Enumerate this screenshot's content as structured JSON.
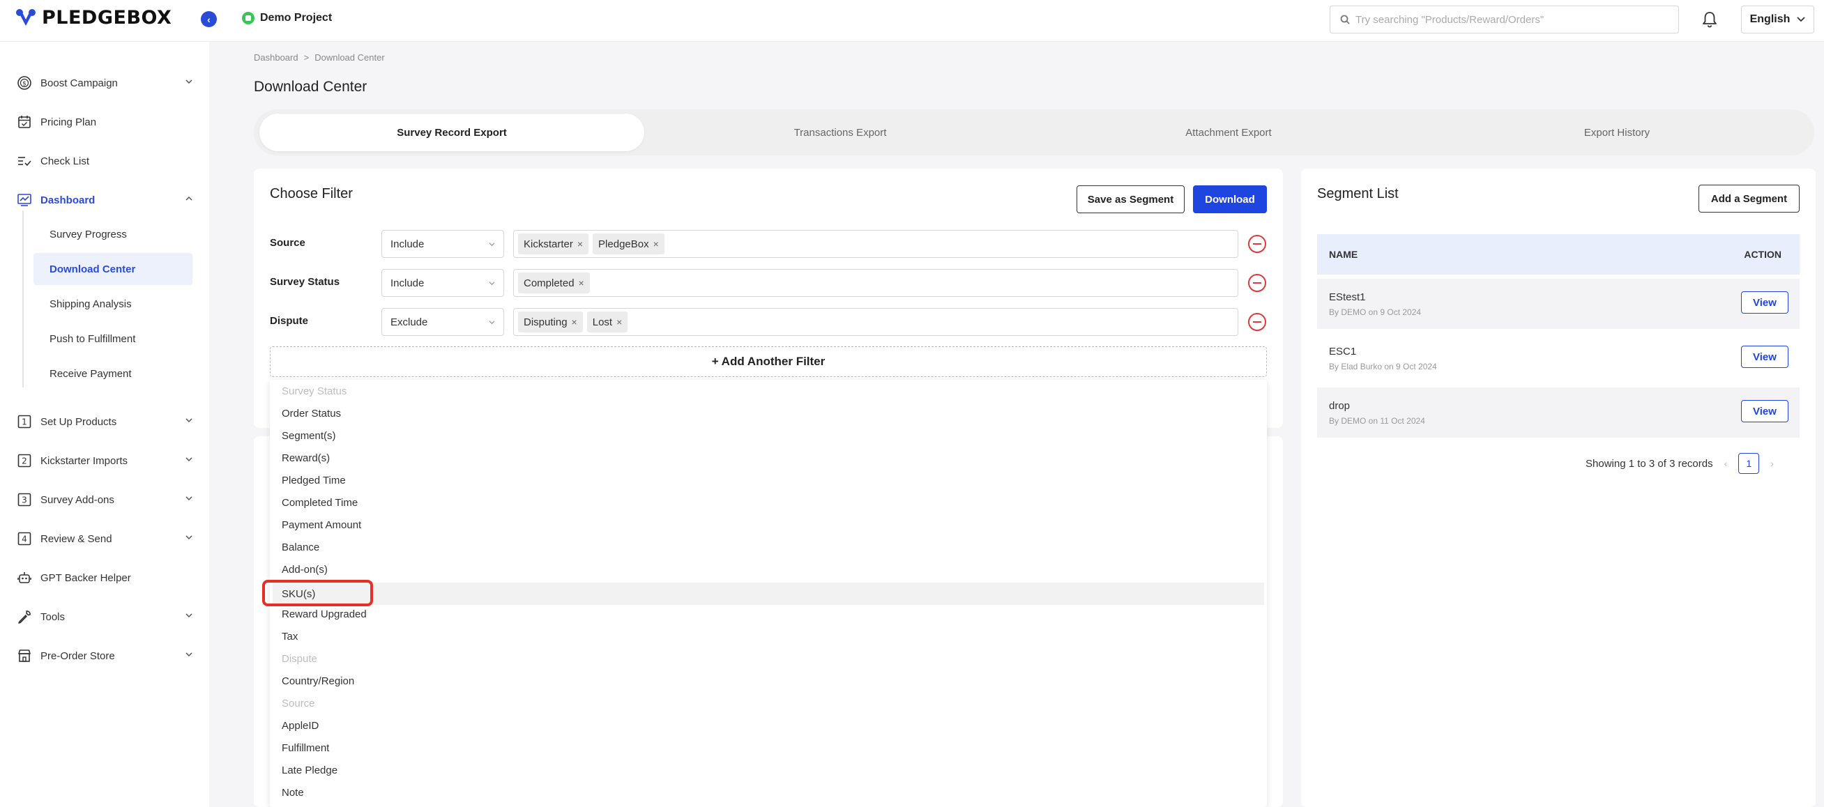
{
  "app": {
    "logo_text": "PLEDGEBOX",
    "project_name": "Demo Project"
  },
  "search": {
    "placeholder": "Try searching \"Products/Reward/Orders\""
  },
  "language": "English",
  "sidebar": {
    "items": [
      {
        "label": "Boost Campaign",
        "icon": "dollar-circle-icon"
      },
      {
        "label": "Pricing Plan",
        "icon": "calendar-icon"
      },
      {
        "label": "Check List",
        "icon": "checklist-icon"
      },
      {
        "label": "Dashboard",
        "icon": "dashboard-chart-icon"
      },
      {
        "label": "Set Up Products",
        "icon": "step-1-icon"
      },
      {
        "label": "Kickstarter Imports",
        "icon": "step-2-icon"
      },
      {
        "label": "Survey Add-ons",
        "icon": "step-3-icon"
      },
      {
        "label": "Review & Send",
        "icon": "step-4-icon"
      },
      {
        "label": "GPT Backer Helper",
        "icon": "robot-icon"
      },
      {
        "label": "Tools",
        "icon": "wrench-icon"
      },
      {
        "label": "Pre-Order Store",
        "icon": "store-icon"
      }
    ],
    "dashboard_sub": [
      {
        "label": "Survey Progress"
      },
      {
        "label": "Download Center"
      },
      {
        "label": "Shipping Analysis"
      },
      {
        "label": "Push to Fulfillment"
      },
      {
        "label": "Receive Payment"
      }
    ]
  },
  "breadcrumb": {
    "root": "Dashboard",
    "sep": ">",
    "current": "Download Center"
  },
  "page_title": "Download Center",
  "tabs": [
    {
      "label": "Survey Record Export"
    },
    {
      "label": "Transactions Export"
    },
    {
      "label": "Attachment Export"
    },
    {
      "label": "Export History"
    }
  ],
  "filter_card": {
    "title": "Choose Filter",
    "save_segment": "Save as Segment",
    "download": "Download",
    "add_filter": "Add Another Filter",
    "add_filter_plus": "+",
    "rows": [
      {
        "label": "Source",
        "mode": "Include",
        "tags": [
          "Kickstarter",
          "PledgeBox"
        ]
      },
      {
        "label": "Survey Status",
        "mode": "Include",
        "tags": [
          "Completed"
        ]
      },
      {
        "label": "Dispute",
        "mode": "Exclude",
        "tags": [
          "Disputing",
          "Lost"
        ]
      }
    ],
    "tag_remove": "×"
  },
  "dropdown": {
    "options": [
      {
        "label": "Survey Status",
        "disabled": true
      },
      {
        "label": "Order Status"
      },
      {
        "label": "Segment(s)"
      },
      {
        "label": "Reward(s)"
      },
      {
        "label": "Pledged Time"
      },
      {
        "label": "Completed Time"
      },
      {
        "label": "Payment Amount"
      },
      {
        "label": "Balance"
      },
      {
        "label": "Add-on(s)"
      },
      {
        "label": "SKU(s)",
        "highlighted": true
      },
      {
        "label": "Reward Upgraded"
      },
      {
        "label": "Tax"
      },
      {
        "label": "Dispute",
        "disabled": true
      },
      {
        "label": "Country/Region"
      },
      {
        "label": "Source",
        "disabled": true
      },
      {
        "label": "AppleID"
      },
      {
        "label": "Fulfillment"
      },
      {
        "label": "Late Pledge"
      },
      {
        "label": "Note"
      }
    ]
  },
  "segment_card": {
    "title": "Segment List",
    "add_button": "Add a Segment",
    "col_name": "NAME",
    "col_action": "ACTION",
    "view_label": "View",
    "rows": [
      {
        "name": "EStest1",
        "meta": "By DEMO on 9 Oct 2024"
      },
      {
        "name": "ESC1",
        "meta": "By Elad Burko on 9 Oct 2024"
      },
      {
        "name": "drop",
        "meta": "By DEMO on 11 Oct 2024"
      }
    ],
    "pagination": {
      "summary": "Showing 1 to 3 of 3 records",
      "current_page": "1",
      "prev": "‹",
      "next": "›"
    }
  },
  "colors": {
    "accent": "#1f45e0",
    "danger": "#e03a3a",
    "success": "#3cc45a",
    "highlight": "#e5302a"
  }
}
